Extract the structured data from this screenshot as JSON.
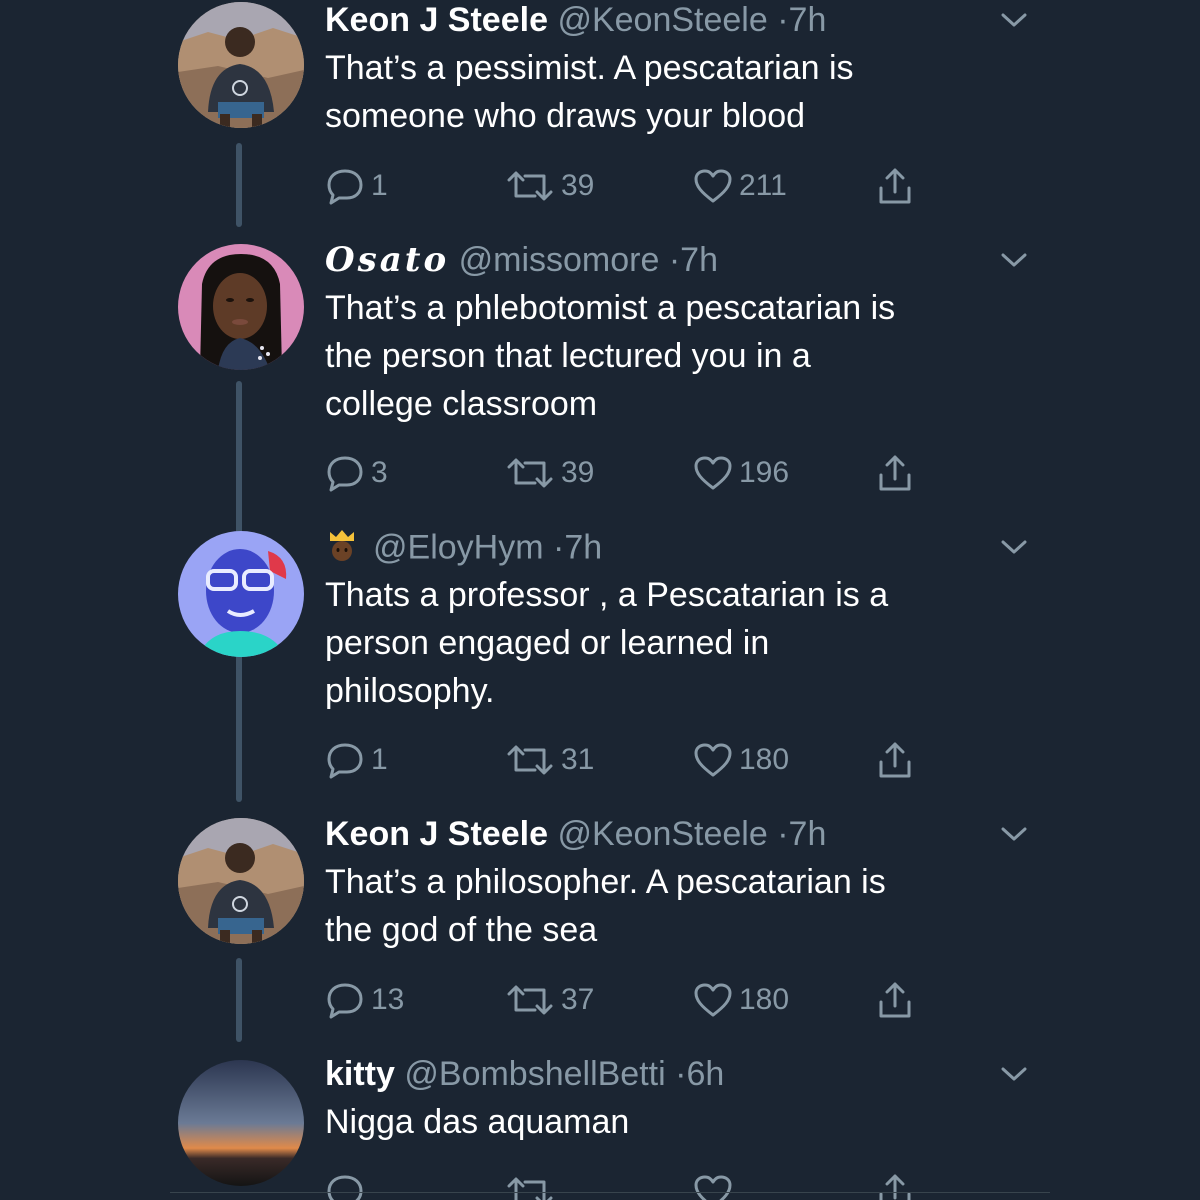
{
  "tweets": [
    {
      "display_name": "Keon J Steele",
      "handle": "@KeonSteele",
      "separator": "·",
      "time": "7h",
      "body_lines": [
        "That’s a pessimist. A pescatarian is",
        "someone who draws your blood"
      ],
      "replies": "1",
      "retweets": "39",
      "likes": "211"
    },
    {
      "display_name": "Osato",
      "handle": "@missomore",
      "separator": "·",
      "time": "7h",
      "body_lines": [
        "That’s a phlebotomist a pescatarian is",
        "the person that lectured you in a",
        "college classroom"
      ],
      "replies": "3",
      "retweets": "39",
      "likes": "196"
    },
    {
      "display_name": "",
      "handle": "@EloyHym",
      "separator": "·",
      "time": "7h",
      "body_lines": [
        "Thats a professor , a Pescatarian is a",
        "person engaged or learned in",
        "philosophy."
      ],
      "replies": "1",
      "retweets": "31",
      "likes": "180"
    },
    {
      "display_name": "Keon J Steele",
      "handle": "@KeonSteele",
      "separator": "·",
      "time": "7h",
      "body_lines": [
        "That’s a philosopher. A pescatarian is",
        "the god of the sea"
      ],
      "replies": "13",
      "retweets": "37",
      "likes": "180"
    },
    {
      "display_name": "kitty",
      "handle": "@BombshellBetti",
      "separator": "·",
      "time": "6h",
      "body_lines": [
        "Nigga das aquaman"
      ],
      "replies": "",
      "retweets": "",
      "likes": ""
    }
  ],
  "icons": {
    "reply": "reply-icon",
    "retweet": "retweet-icon",
    "like": "heart-icon",
    "share": "share-icon",
    "menu": "chevron-down-icon",
    "emoji": "crown-emoji-icon"
  },
  "colors": {
    "background": "#1b2532",
    "text_primary": "#ffffff",
    "text_secondary": "#8899a6",
    "thread_line": "#3f5366"
  }
}
